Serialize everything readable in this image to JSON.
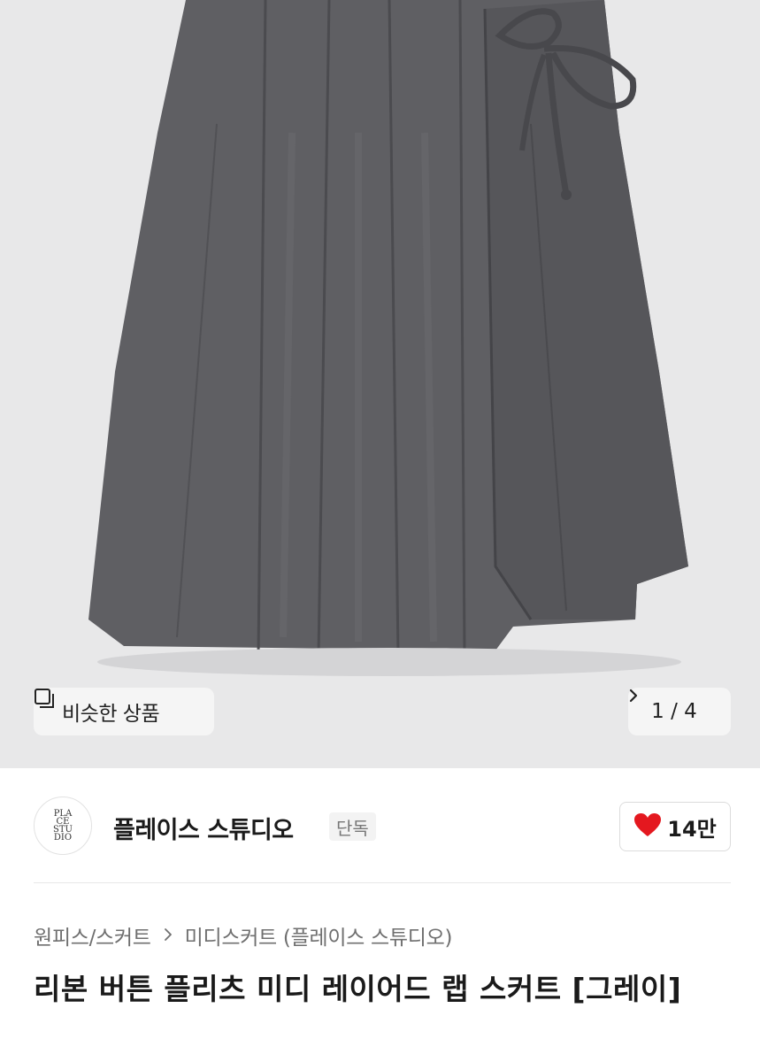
{
  "gallery": {
    "image_alt": "리본 버튼 플리츠 미디 레이어드 랩 스커트 그레이",
    "similar_label": "비슷한 상품",
    "counter": "1 / 4",
    "icons": {
      "similar": "stacked-squares-icon",
      "next": "chevron-right-icon"
    }
  },
  "seller": {
    "logo_text": "PLACE STUDIO",
    "name": "플레이스 스튜디오",
    "badge": "단독",
    "like_count": "14만",
    "like_icon": "heart-icon",
    "like_color": "#e4181f"
  },
  "breadcrumb": {
    "category": "원피스/스커트",
    "subcategory": "미디스커트 (플레이스 스튜디오)",
    "separator_icon": "chevron-right-icon"
  },
  "product": {
    "title": "리본 버튼 플리츠 미디 레이어드 랩 스커트 [그레이]"
  }
}
